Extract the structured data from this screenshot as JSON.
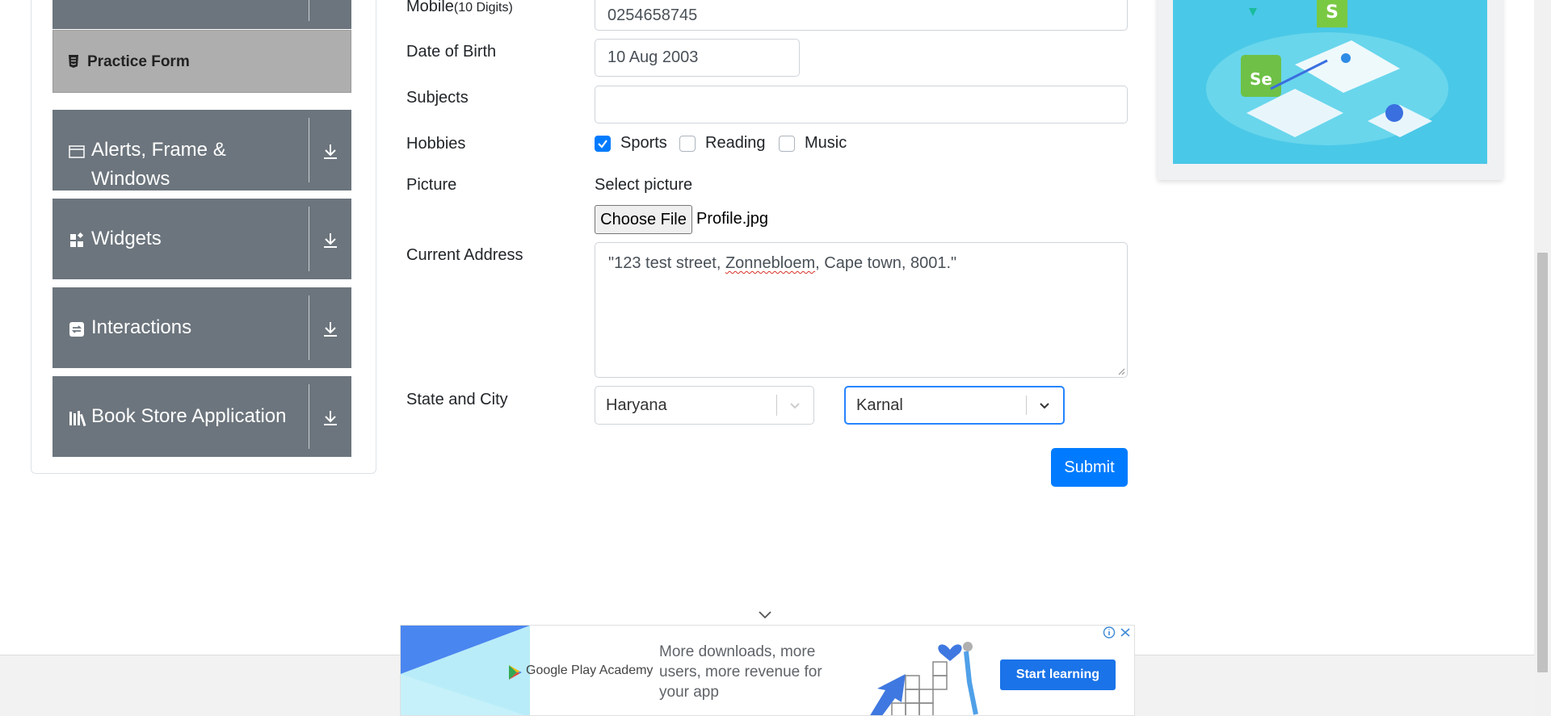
{
  "sidebar": {
    "practice_form": "Practice Form",
    "groups": [
      {
        "line1": "Alerts, Frame &",
        "line2": "Windows"
      },
      {
        "label": "Widgets"
      },
      {
        "label": "Interactions"
      },
      {
        "label": "Book Store Application"
      }
    ]
  },
  "form": {
    "mobile": {
      "label": "Mobile",
      "sub": "(10 Digits)",
      "value": "0254658745"
    },
    "dob": {
      "label": "Date of Birth",
      "value": "10 Aug 2003"
    },
    "subjects": {
      "label": "Subjects",
      "value": ""
    },
    "hobbies": {
      "label": "Hobbies",
      "items": [
        {
          "label": "Sports",
          "checked": true
        },
        {
          "label": "Reading",
          "checked": false
        },
        {
          "label": "Music",
          "checked": false
        }
      ]
    },
    "picture": {
      "label": "Picture",
      "select_label": "Select picture",
      "button": "Choose File",
      "file": "Profile.jpg"
    },
    "address": {
      "label": "Current Address",
      "quote_open": "\"123 test street, ",
      "misspelled": "Zonnebloem",
      "rest": ", Cape town, 8001.\""
    },
    "state_city": {
      "label": "State and City",
      "state": "Haryana",
      "city": "Karnal"
    },
    "submit": "Submit"
  },
  "ad": {
    "brand": "Google Play Academy",
    "message": "More downloads, more users, more revenue for your app",
    "cta": "Start learning"
  },
  "colors": {
    "primary": "#007bff",
    "sidebar_bg": "#6c757d",
    "active_item_bg": "#aeaeae",
    "ad_cta": "#1a73e8"
  }
}
